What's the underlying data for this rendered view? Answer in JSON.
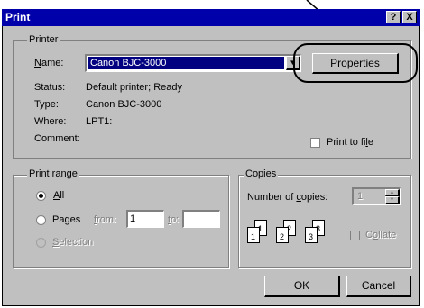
{
  "window": {
    "title": "Print",
    "help_glyph": "?",
    "close_glyph": "X"
  },
  "printer": {
    "group_label": "Printer",
    "name_label": "Name:",
    "name_value": "Canon BJC-3000",
    "properties_label": "Properties",
    "status_label": "Status:",
    "status_value": "Default printer; Ready",
    "type_label": "Type:",
    "type_value": "Canon BJC-3000",
    "where_label": "Where:",
    "where_value": "LPT1:",
    "comment_label": "Comment:",
    "print_to_file_label": "Print to file"
  },
  "print_range": {
    "group_label": "Print range",
    "all_label": "All",
    "pages_label": "Pages",
    "from_label": "from:",
    "from_value": "1",
    "to_label": "to:",
    "to_value": "",
    "selection_label": "Selection",
    "selected": "all"
  },
  "copies": {
    "group_label": "Copies",
    "number_label": "Number of copies:",
    "number_value": "1",
    "collate_label": "Collate",
    "page_numbers": [
      "1",
      "1",
      "2",
      "2",
      "3",
      "3"
    ]
  },
  "buttons": {
    "ok": "OK",
    "cancel": "Cancel"
  },
  "colors": {
    "titlebar": "#0000aa",
    "dialog_face": "#c0c0c0",
    "selection": "#000080"
  }
}
